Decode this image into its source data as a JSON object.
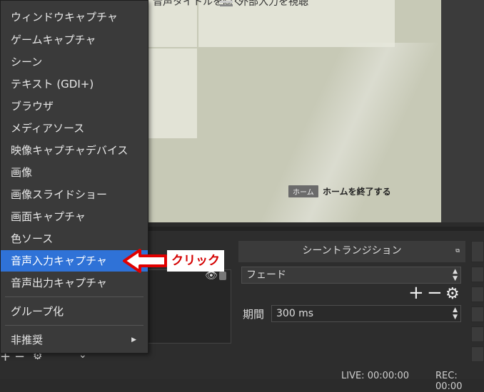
{
  "preview": {
    "top_left_partial": "音声タイトルを隠く",
    "top_right_partial": "外部入力を視聴",
    "home_key": "ホーム",
    "home_label": "ホームを終了する"
  },
  "menu": {
    "items": [
      {
        "label": "ウィンドウキャプチャ"
      },
      {
        "label": "ゲームキャプチャ"
      },
      {
        "label": "シーン"
      },
      {
        "label": "テキスト (GDI+)"
      },
      {
        "label": "ブラウザ"
      },
      {
        "label": "メディアソース"
      },
      {
        "label": "映像キャプチャデバイス"
      },
      {
        "label": "画像"
      },
      {
        "label": "画像スライドショー"
      },
      {
        "label": "画面キャプチャ"
      },
      {
        "label": "色ソース"
      },
      {
        "label": "音声入力キャプチャ",
        "selected": true
      },
      {
        "label": "音声出力キャプチャ"
      }
    ],
    "group_label": "グループ化",
    "deprecated_label": "非推奨"
  },
  "annotation": {
    "text": "クリック",
    "arrow_color": "#e00000"
  },
  "transitions": {
    "header": "シーントランジション",
    "selected": "フェード",
    "duration_label": "期間",
    "duration_value": "300 ms"
  },
  "status": {
    "live": "LIVE: 00:00:00",
    "rec": "REC: 00:00"
  },
  "colors": {
    "accent": "#2f72d7",
    "annotation_red": "#d40000"
  }
}
